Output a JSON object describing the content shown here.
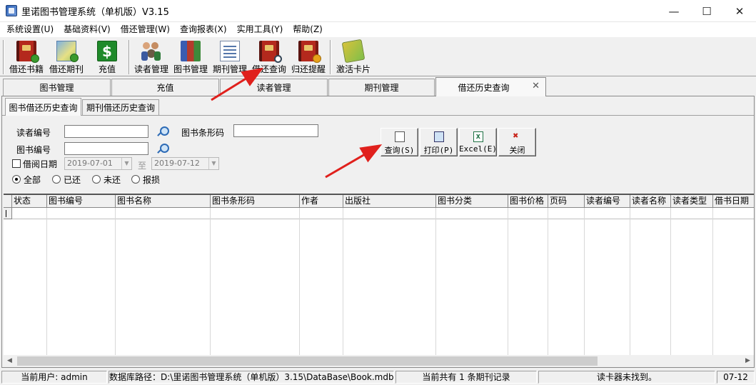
{
  "window": {
    "title": "里诺图书管理系统（单机版）V3.15"
  },
  "menu": [
    "系统设置(U)",
    "基础资料(V)",
    "借还管理(W)",
    "查询报表(X)",
    "实用工具(Y)",
    "帮助(Z)"
  ],
  "toolbar": {
    "borrow_book": "借还书籍",
    "borrow_periodical": "借还期刊",
    "recharge": "充值",
    "reader_mgmt": "读者管理",
    "book_mgmt": "图书管理",
    "periodical_mgmt": "期刊管理",
    "borrow_query": "借还查询",
    "return_reminder": "归还提醒",
    "activate_card": "激活卡片"
  },
  "main_tabs": [
    "图书管理",
    "充值",
    "读者管理",
    "期刊管理",
    "借还历史查询"
  ],
  "sub_tabs": [
    "图书借还历史查询",
    "期刊借还历史查询"
  ],
  "search": {
    "reader_no_label": "读者编号",
    "barcode_label": "图书条形码",
    "book_no_label": "图书编号",
    "borrow_date_label": "借阅日期",
    "date_from": "2019-07-01",
    "to_label": "至",
    "date_to": "2019-07-12",
    "status_options": [
      "全部",
      "已还",
      "未还",
      "报损"
    ]
  },
  "actions": {
    "query": "查询(S)",
    "print": "打印(P)",
    "excel": "Excel(E)",
    "close": "关闭"
  },
  "grid": {
    "columns": [
      "状态",
      "图书编号",
      "图书名称",
      "图书条形码",
      "作者",
      "出版社",
      "图书分类",
      "图书价格",
      "页码",
      "读者编号",
      "读者名称",
      "读者类型",
      "借书日期"
    ]
  },
  "statusbar": {
    "user": "当前用户: admin",
    "db_path": "数据库路径：D:\\里诺图书管理系统（单机版）3.15\\DataBase\\Book.mdb",
    "record_count": "当前共有 1 条期刊记录",
    "card_reader": "读卡器未找到。",
    "date": "07-12"
  },
  "colors": {
    "annotation_arrow": "#e0201c"
  }
}
